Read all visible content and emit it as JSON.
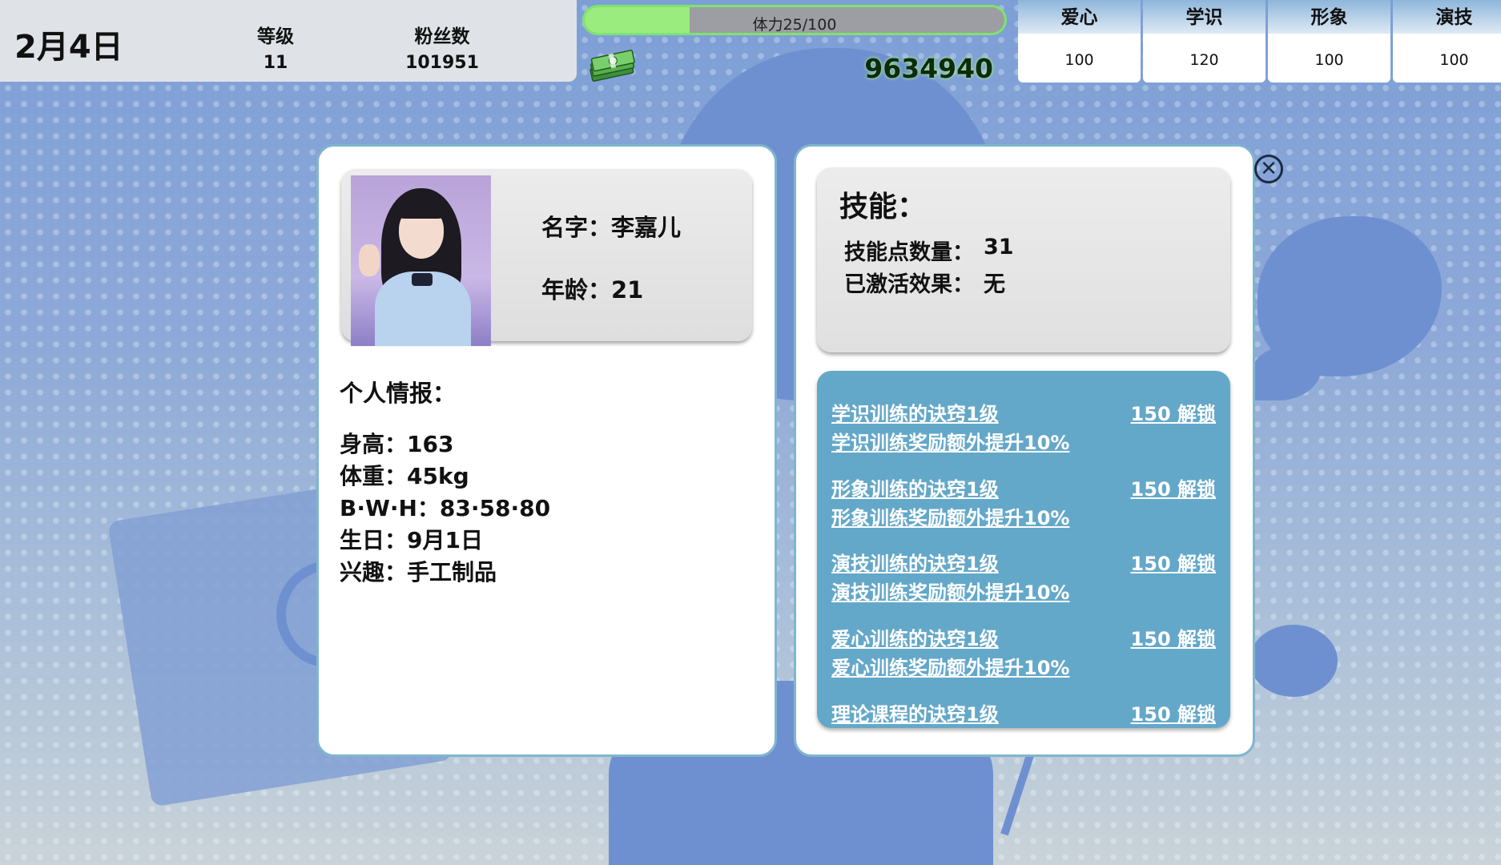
{
  "header": {
    "date": "2月4日",
    "level_label": "等级",
    "level_value": "11",
    "fans_label": "粉丝数",
    "fans_value": "101951",
    "stamina_text": "体力25/100",
    "stamina_fraction": 0.25,
    "money": "9634940",
    "money_icon": "cash-stack-icon"
  },
  "attributes": [
    {
      "label": "爱心",
      "value": "100"
    },
    {
      "label": "学识",
      "value": "120"
    },
    {
      "label": "形象",
      "value": "100"
    },
    {
      "label": "演技",
      "value": "100"
    }
  ],
  "profile": {
    "name_line": "名字：李嘉儿",
    "age_line": "年龄：21",
    "info_title": "个人情报：",
    "info": [
      "身高：163",
      "体重：45kg",
      "B·W·H：83·58·80",
      "生日：9月1日",
      "兴趣：手工制品"
    ]
  },
  "skills": {
    "title": "技能：",
    "points_label": "技能点数量：",
    "points_value": "31",
    "active_label": "已激活效果：",
    "active_value": "无",
    "list": [
      {
        "name": "学识训练的诀窍1级",
        "desc": "学识训练奖励额外提升10%",
        "unlock": "150 解锁"
      },
      {
        "name": "形象训练的诀窍1级",
        "desc": "形象训练奖励额外提升10%",
        "unlock": "150 解锁"
      },
      {
        "name": "演技训练的诀窍1级",
        "desc": "演技训练奖励额外提升10%",
        "unlock": "150 解锁"
      },
      {
        "name": "爱心训练的诀窍1级",
        "desc": "爱心训练奖励额外提升10%",
        "unlock": "150 解锁"
      },
      {
        "name": "理论课程的诀窍1级",
        "desc": "",
        "unlock": "150 解锁"
      }
    ]
  },
  "close_icon": "close-circle-icon",
  "colors": {
    "stamina_border": "#7ee36e",
    "panel_border": "#7fb6cf",
    "skill_list_bg": "#64a8c9",
    "money_glow": "#aaf09a"
  }
}
